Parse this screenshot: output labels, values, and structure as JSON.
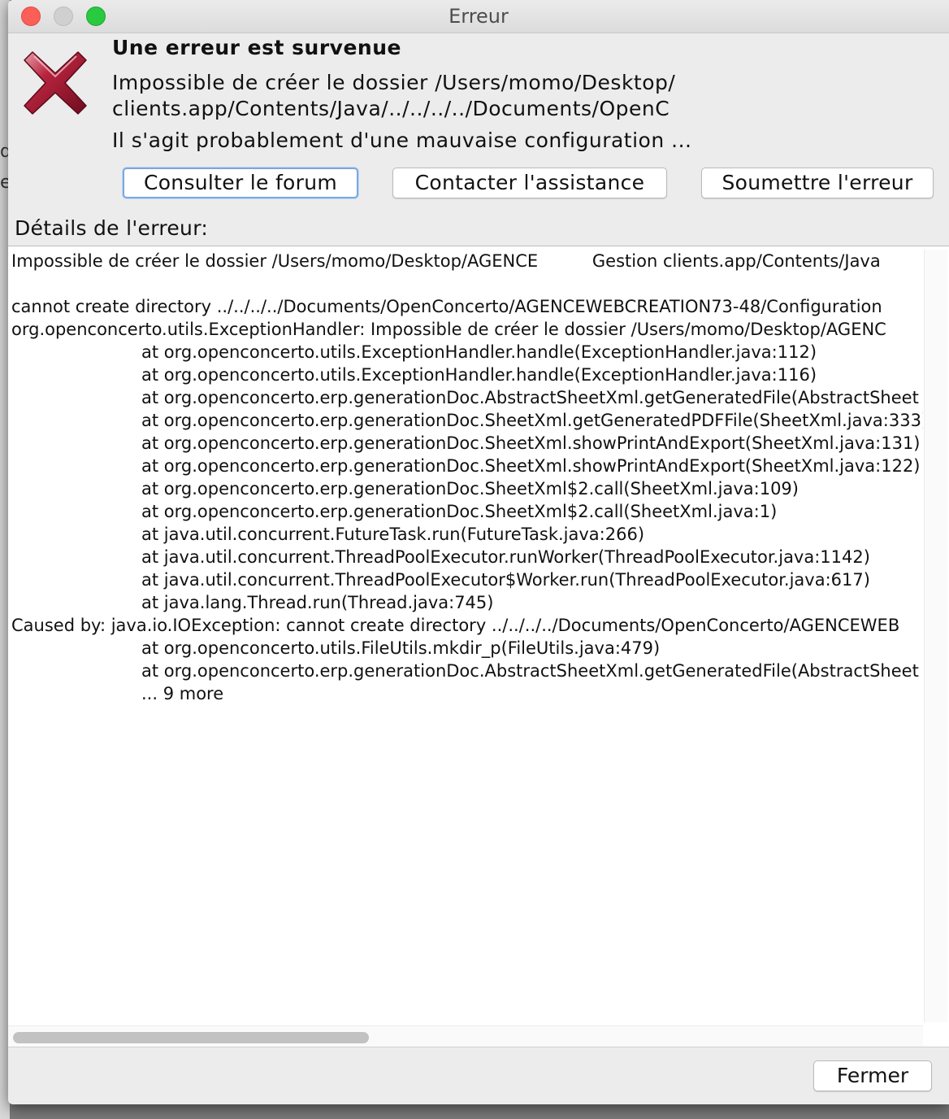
{
  "window": {
    "title": "Erreur"
  },
  "backdrop": {
    "fragments": [
      "d",
      "ei"
    ]
  },
  "dialog": {
    "heading": "Une erreur est survenue",
    "message_lines": [
      "Impossible de créer le dossier /Users/momo/Desktop/",
      "clients.app/Contents/Java/../../../../Documents/OpenC"
    ],
    "hint": "Il s'agit probablement d'une mauvaise configuration ...",
    "icon": "error-x-icon",
    "icon_color": "#9e1b32"
  },
  "buttons": {
    "forum": "Consulter le forum",
    "contact": "Contacter l'assistance",
    "submit": "Soumettre l'erreur",
    "close": "Fermer"
  },
  "details": {
    "label": "Détails de l'erreur:",
    "lines": [
      {
        "text": "Impossible de créer le dossier /Users/momo/Desktop/AGENCE          Gestion clients.app/Contents/Java",
        "indent": false
      },
      {
        "text": "",
        "indent": false
      },
      {
        "text": "cannot create directory ../../../../Documents/OpenConcerto/AGENCEWEBCREATION73-48/Configuration",
        "indent": false
      },
      {
        "text": "org.openconcerto.utils.ExceptionHandler: Impossible de créer le dossier /Users/momo/Desktop/AGENC",
        "indent": false
      },
      {
        "text": "at org.openconcerto.utils.ExceptionHandler.handle(ExceptionHandler.java:112)",
        "indent": true
      },
      {
        "text": "at org.openconcerto.utils.ExceptionHandler.handle(ExceptionHandler.java:116)",
        "indent": true
      },
      {
        "text": "at org.openconcerto.erp.generationDoc.AbstractSheetXml.getGeneratedFile(AbstractSheet",
        "indent": true
      },
      {
        "text": "at org.openconcerto.erp.generationDoc.SheetXml.getGeneratedPDFFile(SheetXml.java:333)",
        "indent": true
      },
      {
        "text": "at org.openconcerto.erp.generationDoc.SheetXml.showPrintAndExport(SheetXml.java:131)",
        "indent": true
      },
      {
        "text": "at org.openconcerto.erp.generationDoc.SheetXml.showPrintAndExport(SheetXml.java:122)",
        "indent": true
      },
      {
        "text": "at org.openconcerto.erp.generationDoc.SheetXml$2.call(SheetXml.java:109)",
        "indent": true
      },
      {
        "text": "at org.openconcerto.erp.generationDoc.SheetXml$2.call(SheetXml.java:1)",
        "indent": true
      },
      {
        "text": "at java.util.concurrent.FutureTask.run(FutureTask.java:266)",
        "indent": true
      },
      {
        "text": "at java.util.concurrent.ThreadPoolExecutor.runWorker(ThreadPoolExecutor.java:1142)",
        "indent": true
      },
      {
        "text": "at java.util.concurrent.ThreadPoolExecutor$Worker.run(ThreadPoolExecutor.java:617)",
        "indent": true
      },
      {
        "text": "at java.lang.Thread.run(Thread.java:745)",
        "indent": true
      },
      {
        "text": "Caused by: java.io.IOException: cannot create directory ../../../../Documents/OpenConcerto/AGENCEWEB",
        "indent": false
      },
      {
        "text": "at org.openconcerto.utils.FileUtils.mkdir_p(FileUtils.java:479)",
        "indent": true
      },
      {
        "text": "at org.openconcerto.erp.generationDoc.AbstractSheetXml.getGeneratedFile(AbstractSheet",
        "indent": true
      },
      {
        "text": "... 9 more",
        "indent": true
      }
    ]
  }
}
